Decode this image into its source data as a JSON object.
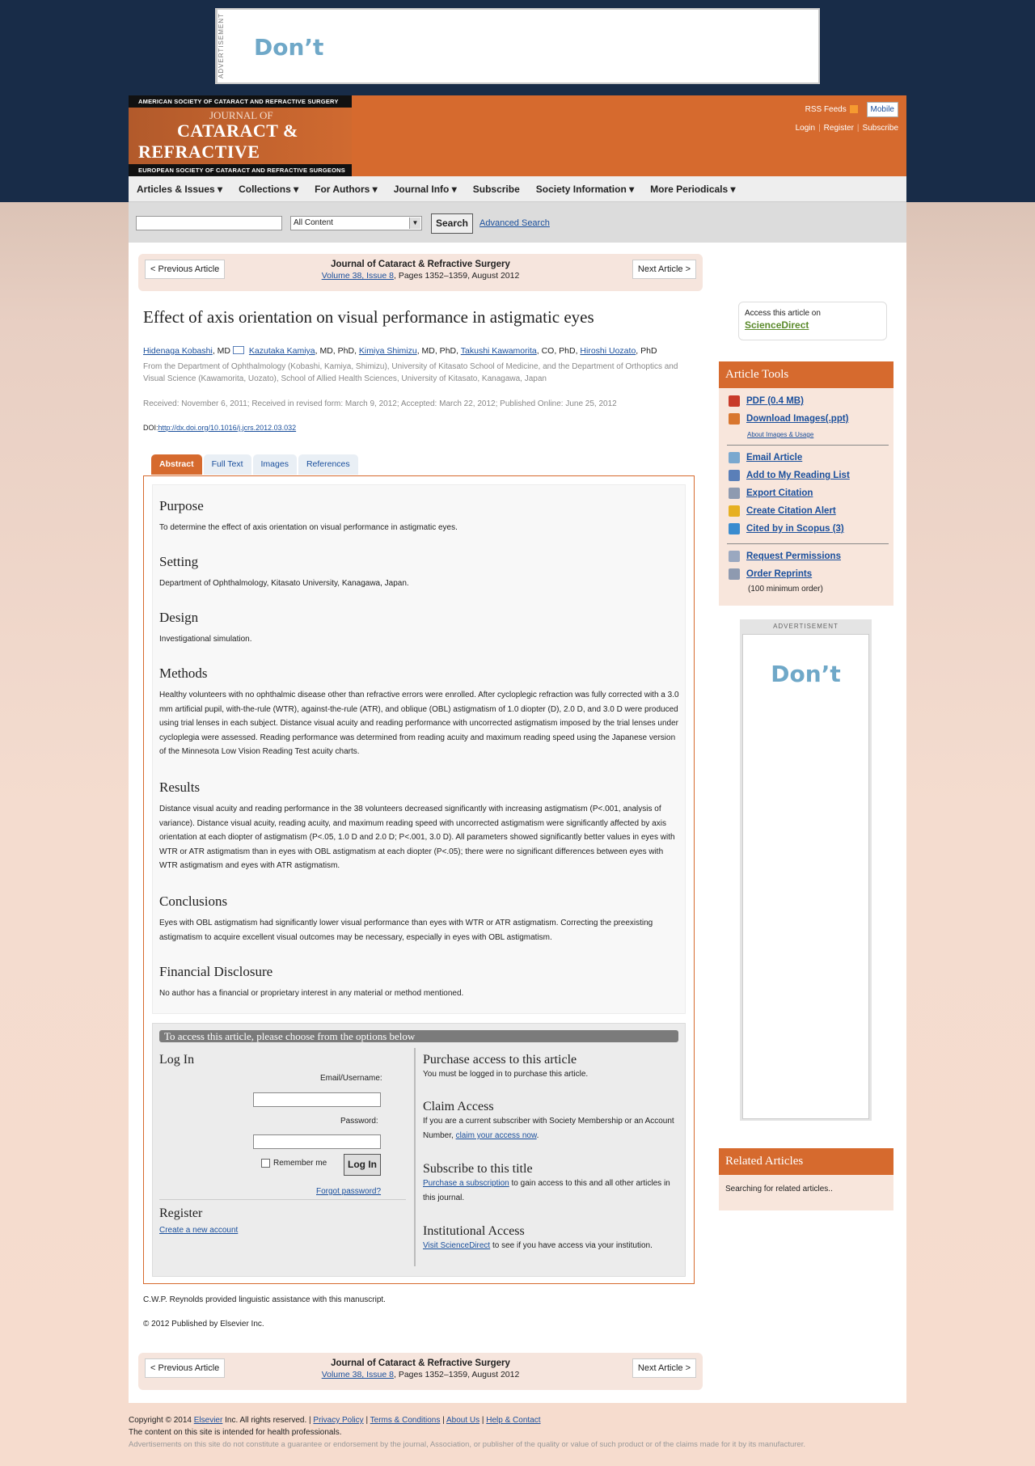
{
  "ad_top": {
    "label": "ADVERTISEMENT",
    "text": "Don’t"
  },
  "header": {
    "society_top": "AMERICAN SOCIETY OF CATARACT AND REFRACTIVE SURGERY",
    "logo_line1": "JOURNAL OF",
    "logo_line2": "CATARACT &",
    "logo_line3": "REFRACTIVE SURGERY",
    "society_bottom": "EUROPEAN SOCIETY OF CATARACT AND REFRACTIVE SURGEONS",
    "rss": "RSS Feeds",
    "mobile": "Mobile",
    "login": "Login",
    "register": "Register",
    "subscribe": "Subscribe"
  },
  "nav": {
    "items": [
      "Articles & Issues ▾",
      "Collections ▾",
      "For Authors ▾",
      "Journal Info ▾",
      "Subscribe",
      "Society Information ▾",
      "More Periodicals ▾"
    ]
  },
  "search": {
    "select_value": "All Content",
    "button": "Search",
    "advanced": "Advanced Search"
  },
  "article_nav": {
    "prev": "< Previous Article",
    "next": "Next Article >",
    "journal": "Journal of Cataract & Refractive Surgery",
    "volume_link": "Volume 38, Issue 8",
    "pages": ", Pages 1352–1359, August 2012"
  },
  "article": {
    "title": "Effect of axis orientation on visual performance in astigmatic eyes",
    "authors": [
      {
        "name": "Hidenaga Kobashi",
        "deg": ", MD"
      },
      {
        "name": "Kazutaka Kamiya",
        "deg": ", MD, PhD,"
      },
      {
        "name": "Kimiya Shimizu",
        "deg": ", MD, PhD,"
      },
      {
        "name": "Takushi Kawamorita",
        "deg": ", CO, PhD,"
      },
      {
        "name": "Hiroshi Uozato",
        "deg": ", PhD"
      }
    ],
    "affiliation": "From the Department of Ophthalmology (Kobashi, Kamiya, Shimizu), University of Kitasato School of Medicine, and the Department of Orthoptics and Visual Science (Kawamorita, Uozato), School of Allied Health Sciences, University of Kitasato, Kanagawa, Japan",
    "dates": "Received: November 6, 2011; Received in revised form: March 9, 2012; Accepted: March 22, 2012; Published Online: June 25, 2012",
    "doi_label": "DOI:",
    "doi": "http://dx.doi.org/10.1016/j.jcrs.2012.03.032"
  },
  "tabs": [
    "Abstract",
    "Full Text",
    "Images",
    "References"
  ],
  "abstract": {
    "purpose_h": "Purpose",
    "purpose": "To determine the effect of axis orientation on visual performance in astigmatic eyes.",
    "setting_h": "Setting",
    "setting": "Department of Ophthalmology, Kitasato University, Kanagawa, Japan.",
    "design_h": "Design",
    "design": "Investigational simulation.",
    "methods_h": "Methods",
    "methods": "Healthy volunteers with no ophthalmic disease other than refractive errors were enrolled. After cycloplegic refraction was fully corrected with a 3.0 mm artificial pupil, with-the-rule (WTR), against-the-rule (ATR), and oblique (OBL) astigmatism of 1.0 diopter (D), 2.0 D, and 3.0 D were produced using trial lenses in each subject. Distance visual acuity and reading performance with uncorrected astigmatism imposed by the trial lenses under cycloplegia were assessed. Reading performance was determined from reading acuity and maximum reading speed using the Japanese version of the Minnesota Low Vision Reading Test acuity charts.",
    "results_h": "Results",
    "results": "Distance visual acuity and reading performance in the 38 volunteers decreased significantly with increasing astigmatism (P<.001, analysis of variance). Distance visual acuity, reading acuity, and maximum reading speed with uncorrected astigmatism were significantly affected by axis orientation at each diopter of astigmatism (P<.05, 1.0 D and 2.0 D; P<.001, 3.0 D). All parameters showed significantly better values in eyes with WTR or ATR astigmatism than in eyes with OBL astigmatism at each diopter (P<.05); there were no significant differences between eyes with WTR astigmatism and eyes with ATR astigmatism.",
    "conclusions_h": "Conclusions",
    "conclusions": "Eyes with OBL astigmatism had significantly lower visual performance than eyes with WTR or ATR astigmatism. Correcting the preexisting astigmatism to acquire excellent visual outcomes may be necessary, especially in eyes with OBL astigmatism.",
    "financial_h": "Financial Disclosure",
    "financial": "No author has a financial or proprietary interest in any material or method mentioned."
  },
  "access": {
    "bar": "To access this article, please choose from the options below",
    "login_h": "Log In",
    "email_label": "Email/Username:",
    "password_label": "Password:",
    "remember": "Remember me",
    "login_btn": "Log In",
    "forgot": "Forgot password?",
    "register_h": "Register",
    "create": "Create a new account",
    "purchase_h": "Purchase access to this article",
    "purchase": "You must be logged in to purchase this article.",
    "claim_h": "Claim Access",
    "claim_pre": "If you are a current subscriber with Society Membership or an Account Number, ",
    "claim_link": "claim your access now",
    "claim_post": ".",
    "sub_h": "Subscribe to this title",
    "sub_link": "Purchase a subscription",
    "sub_post": " to gain access to this and all other articles in this journal.",
    "inst_h": "Institutional Access",
    "inst_link": "Visit ScienceDirect",
    "inst_post": " to see if you have access via your institution."
  },
  "ack": "C.W.P. Reynolds provided linguistic assistance with this manuscript.",
  "copyright_article": "© 2012 Published by Elsevier Inc.",
  "sidebar": {
    "access_on": "Access this article on",
    "sciencedirect": "ScienceDirect",
    "tools_h": "Article Tools",
    "pdf": "PDF (0.4 MB)",
    "download_images": "Download Images(.ppt)",
    "about_images": "About Images & Usage",
    "email": "Email Article",
    "reading_list": "Add to My Reading List",
    "export": "Export Citation",
    "alert": "Create Citation Alert",
    "scopus": "Cited by in Scopus (3)",
    "permissions": "Request Permissions",
    "reprints": "Order Reprints",
    "reprints_note": "(100 minimum order)",
    "ad_label": "ADVERTISEMENT",
    "ad_text": "Don’t",
    "related_h": "Related Articles",
    "related_text": "Searching for related articles.."
  },
  "footer": {
    "copy_pre": "Copyright © 2014 ",
    "elsevier": "Elsevier",
    "copy_post": " Inc. All rights reserved. | ",
    "privacy": "Privacy Policy",
    "terms": "Terms & Conditions",
    "about": "About Us",
    "help": "Help & Contact",
    "health": "The content on this site is intended for health professionals.",
    "disclaimer": "Advertisements on this site do not constitute a guarantee or endorsement by the journal, Association, or publisher of the quality or value of such product or of the claims made for it by its manufacturer."
  }
}
